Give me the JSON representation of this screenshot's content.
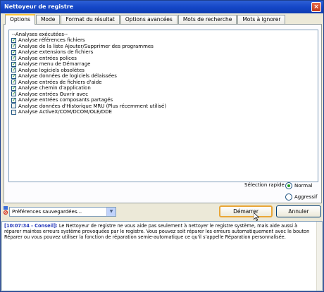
{
  "window": {
    "title": "Nettoyeur de registre",
    "close_glyph": "×"
  },
  "tabs": [
    {
      "label": "Options",
      "active": true
    },
    {
      "label": "Mode"
    },
    {
      "label": "Format du résultat"
    },
    {
      "label": "Options avancées"
    },
    {
      "label": "Mots de recherche"
    },
    {
      "label": "Mots à ignorer"
    }
  ],
  "list": {
    "header": "--Analyses exécutées--",
    "items": [
      {
        "label": "Analyse références fichiers",
        "checked": true
      },
      {
        "label": "Analyse de la liste Ajouter/Supprimer des programmes",
        "checked": true
      },
      {
        "label": "Analyse extensions de fichiers",
        "checked": true
      },
      {
        "label": "Analyse entrées polices",
        "checked": true
      },
      {
        "label": "Analyse menu de Démarrage",
        "checked": true
      },
      {
        "label": "Analyse logiciels obsolètes",
        "checked": true
      },
      {
        "label": "Analyse données de logiciels délaissées",
        "checked": true
      },
      {
        "label": "Analyse entrées de fichiers d'aide",
        "checked": true
      },
      {
        "label": "Analyse chemin d'application",
        "checked": true
      },
      {
        "label": "Analyse entrées Ouvrir avec",
        "checked": true
      },
      {
        "label": "Analyse entrées composants partagés",
        "checked": true
      },
      {
        "label": "Analyse données d'Historique MRU (Plus récemment utilisé)",
        "checked": false
      },
      {
        "label": "Analyse ActiveX/COM/DCOM/OLE/DDE",
        "checked": false
      }
    ]
  },
  "quick_select": {
    "label": "Sélection rapide",
    "options": [
      {
        "label": "Normal",
        "selected": true
      },
      {
        "label": "Aggressif",
        "selected": false
      }
    ]
  },
  "preferences": {
    "value": "Préférences sauvegardées...",
    "arrow": "▼"
  },
  "buttons": {
    "start": "Démarrer",
    "cancel": "Annuler"
  },
  "log": {
    "timestamp": "[10:07:34 - Conseil]:",
    "message": " Le Nettoyeur de registre ne vous aide pas seulement à nettoyer le registre système, mais  aide aussi à réparer maintes erreurs système provoquées par le registre. Vous pouvez soit réparer les erreurs automatiquement avec le bouton Réparer ou vous pouvez utiliser la fonction de réparation semie-automatique ce qu'il s'appelle Réparation personnalisée."
  },
  "colors": {
    "title_bar": "#1547c7",
    "check_mark": "#21a121",
    "default_button_border": "#e9a637",
    "log_stamp": "#2034b8"
  }
}
